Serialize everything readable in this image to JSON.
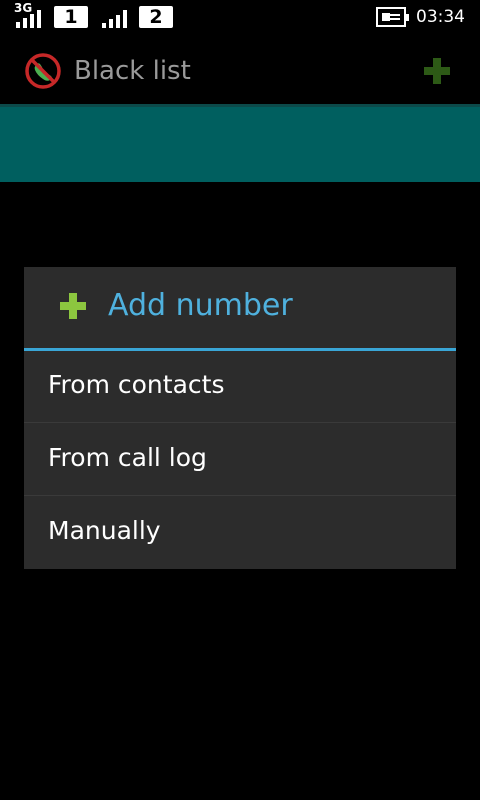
{
  "status_bar": {
    "network_type": "3G",
    "sim1": "1",
    "sim2": "2",
    "time": "03:34"
  },
  "action_bar": {
    "title": "Black list",
    "icon": "blocked-phone-icon",
    "action_icon": "plus-icon"
  },
  "dialog": {
    "title": "Add number",
    "options": [
      {
        "label": "From contacts"
      },
      {
        "label": "From call log"
      },
      {
        "label": "Manually"
      }
    ]
  },
  "colors": {
    "teal": "#005f5f",
    "accent": "#3aa6d6",
    "plus_green": "#8cc63f",
    "dialog_bg": "#2c2c2c"
  }
}
